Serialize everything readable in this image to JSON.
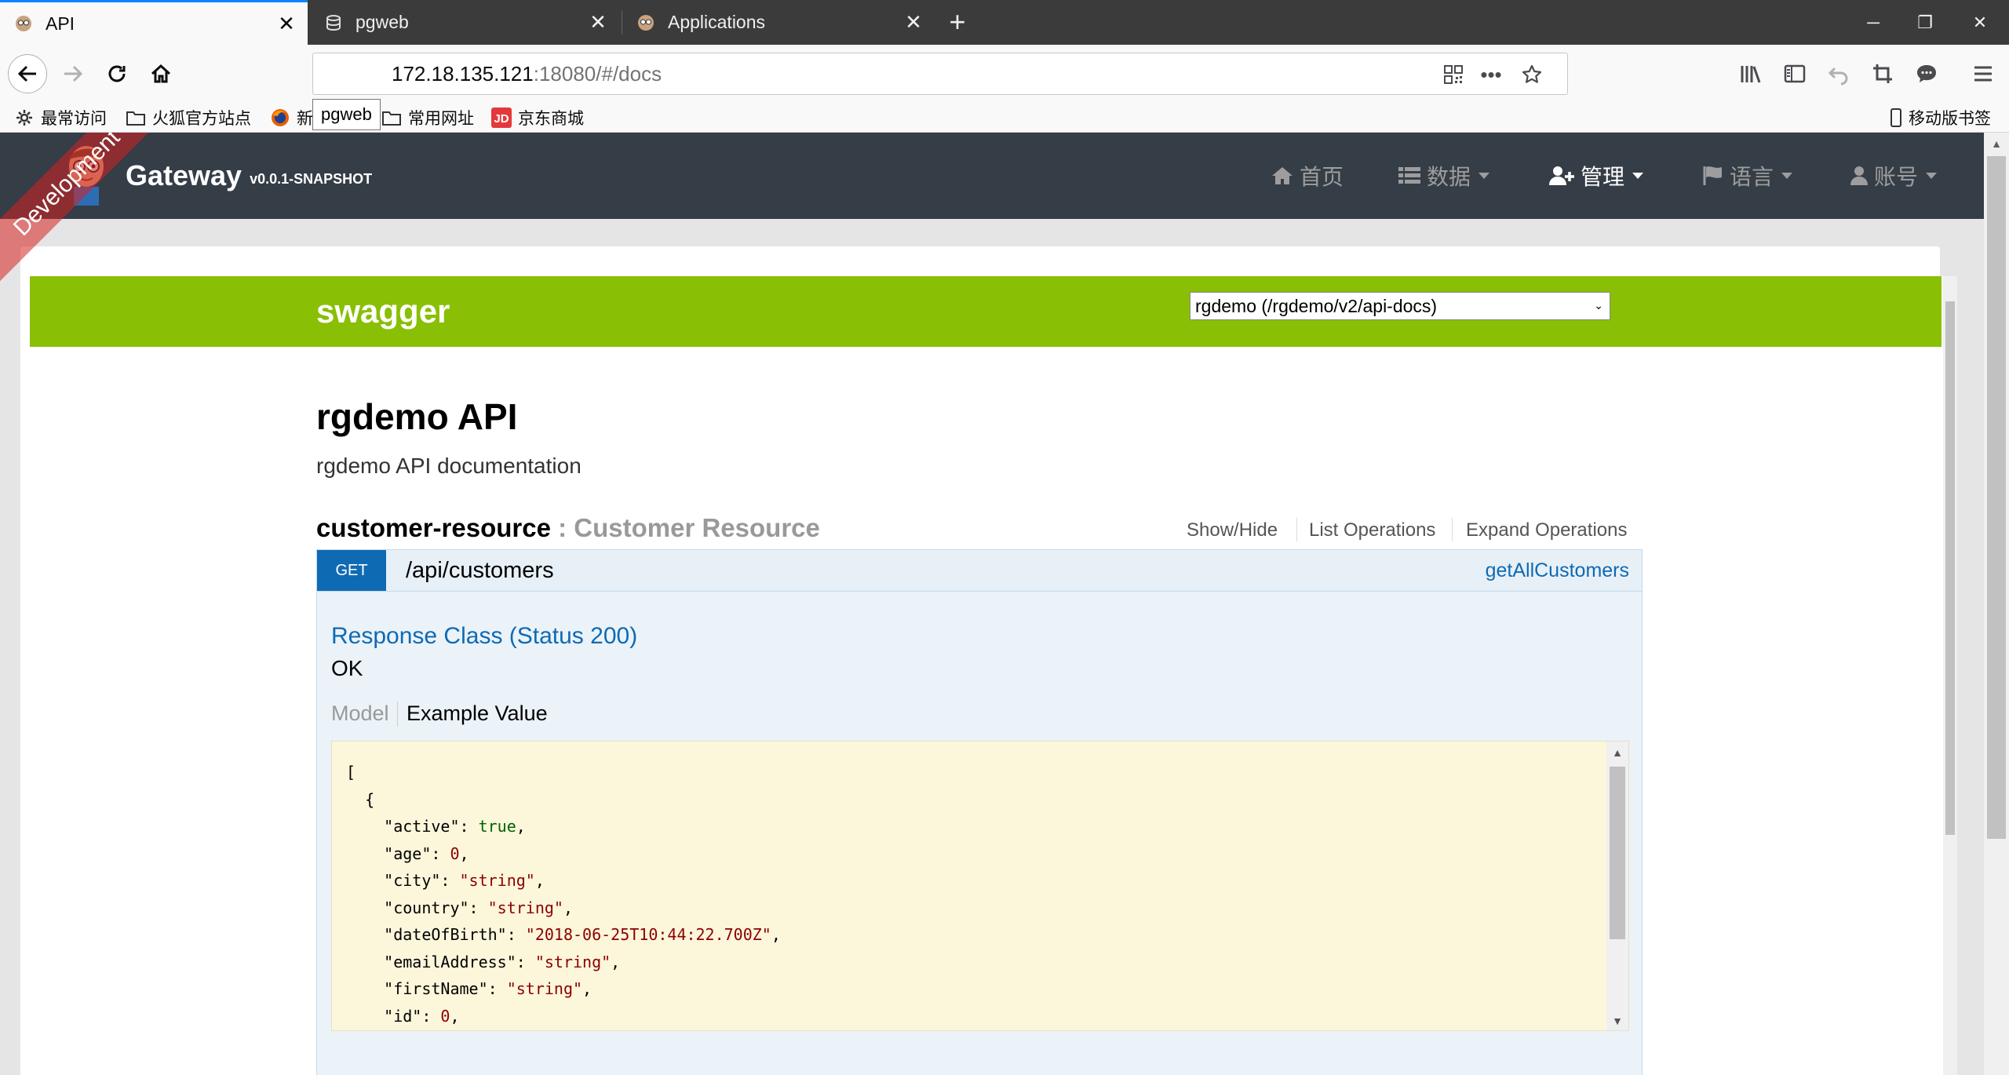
{
  "tabs": [
    {
      "title": "API",
      "close": "✕"
    },
    {
      "title": "pgweb",
      "close": "✕"
    },
    {
      "title": "Applications",
      "close": "✕"
    }
  ],
  "window": {
    "new_tab": "+",
    "minimize": "─",
    "restore": "❐",
    "close": "✕"
  },
  "urlbar": {
    "host": "172.18.135.121",
    "rest": ":18080/#/docs",
    "tooltip": "pgweb",
    "more": "•••"
  },
  "bookmarks": [
    {
      "label": "最常访问",
      "icon": "gear-icon"
    },
    {
      "label": "火狐官方站点",
      "icon": "folder-icon"
    },
    {
      "label": "新手上路",
      "icon": "firefox-icon"
    },
    {
      "label": "常用网址",
      "icon": "folder-icon"
    },
    {
      "label": "京东商城",
      "icon": "jd-icon"
    }
  ],
  "bookmarks_right": "移动版书签",
  "app": {
    "title": "Gateway",
    "version": "v0.0.1-SNAPSHOT",
    "ribbon": "Development",
    "menu": [
      {
        "label": "首页",
        "icon": "home-icon",
        "dropdown": false,
        "active": false
      },
      {
        "label": "数据",
        "icon": "list-icon",
        "dropdown": true,
        "active": false
      },
      {
        "label": "管理",
        "icon": "user-plus-icon",
        "dropdown": true,
        "active": true
      },
      {
        "label": "语言",
        "icon": "flag-icon",
        "dropdown": true,
        "active": false
      },
      {
        "label": "账号",
        "icon": "user-icon",
        "dropdown": true,
        "active": false
      }
    ]
  },
  "swagger": {
    "logo": "swagger",
    "spec_select": "rgdemo (/rgdemo/v2/api-docs)",
    "api_title": "rgdemo API",
    "api_description": "rgdemo API documentation",
    "resource": {
      "name": "customer-resource",
      "description": " : Customer Resource",
      "ops": [
        "Show/Hide",
        "List Operations",
        "Expand Operations"
      ]
    },
    "operation": {
      "method": "GET",
      "path": "/api/customers",
      "summary": "getAllCustomers",
      "response_class": "Response Class (Status 200)",
      "response_status": "OK",
      "tab_model": "Model",
      "tab_example": "Example Value"
    },
    "example_lines": [
      "[",
      "  {",
      "    \"active\": true,",
      "    \"age\": 0,",
      "    \"city\": \"string\",",
      "    \"country\": \"string\",",
      "    \"dateOfBirth\": \"2018-06-25T10:44:22.700Z\",",
      "    \"emailAddress\": \"string\",",
      "    \"firstName\": \"string\",",
      "    \"id\": 0,"
    ]
  },
  "colors": {
    "swagger_green": "#89bf04",
    "get_blue": "#0f6ab4",
    "app_navbar": "#353d47",
    "ribbon": "#d52020"
  }
}
